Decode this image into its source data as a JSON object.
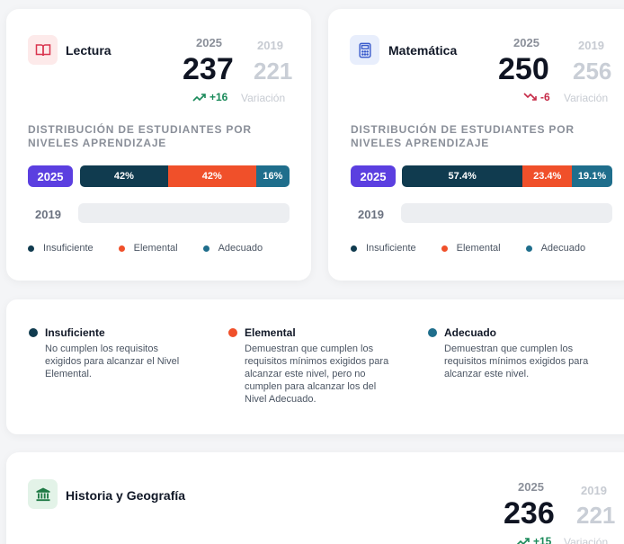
{
  "colors": {
    "insuficiente": "#103b4f",
    "elemental": "#f0502a",
    "adecuado": "#1f6e8c",
    "year_pill": "#5b3fe0",
    "up": "#1a8a5a",
    "down": "#c62a47"
  },
  "lectura": {
    "title": "Lectura",
    "icon": "book-icon",
    "year_a": "2025",
    "year_b": "2019",
    "score_a": "237",
    "score_b": "221",
    "delta": "+16",
    "delta_label": "Variación",
    "dist_title": "DISTRIBUCIÓN DE ESTUDIANTES POR NIVELES APRENDIZAJE",
    "row1_year": "2025",
    "row2_year": "2019",
    "segments": [
      {
        "label": "42%",
        "value": 42
      },
      {
        "label": "42%",
        "value": 42
      },
      {
        "label": "16%",
        "value": 16
      }
    ]
  },
  "matematica": {
    "title": "Matemática",
    "icon": "calculator-icon",
    "year_a": "2025",
    "year_b": "2019",
    "score_a": "250",
    "score_b": "256",
    "delta": "-6",
    "delta_label": "Variación",
    "dist_title": "DISTRIBUCIÓN DE ESTUDIANTES POR NIVELES APRENDIZAJE",
    "row1_year": "2025",
    "row2_year": "2019",
    "segments": [
      {
        "label": "57.4%",
        "value": 57.4
      },
      {
        "label": "23.4%",
        "value": 23.4
      },
      {
        "label": "19.1%",
        "value": 19.1
      }
    ]
  },
  "legend": {
    "insuficiente": "Insuficiente",
    "elemental": "Elemental",
    "adecuado": "Adecuado"
  },
  "levels": [
    {
      "title": "Insuficiente",
      "desc": "No cumplen los requisitos exigidos para alcanzar el Nivel Elemental."
    },
    {
      "title": "Elemental",
      "desc": "Demuestran que cumplen los requisitos mínimos exigidos para alcanzar este nivel, pero no cumplen para alcanzar los del Nivel Adecuado."
    },
    {
      "title": "Adecuado",
      "desc": "Demuestran que cumplen los requisitos mínimos exigidos para alcanzar este nivel."
    }
  ],
  "historia": {
    "title": "Historia y Geografía",
    "icon": "museum-icon",
    "year_a": "2025",
    "year_b": "2019",
    "score_a": "236",
    "score_b": "221",
    "delta": "+15",
    "delta_label": "Variación"
  }
}
